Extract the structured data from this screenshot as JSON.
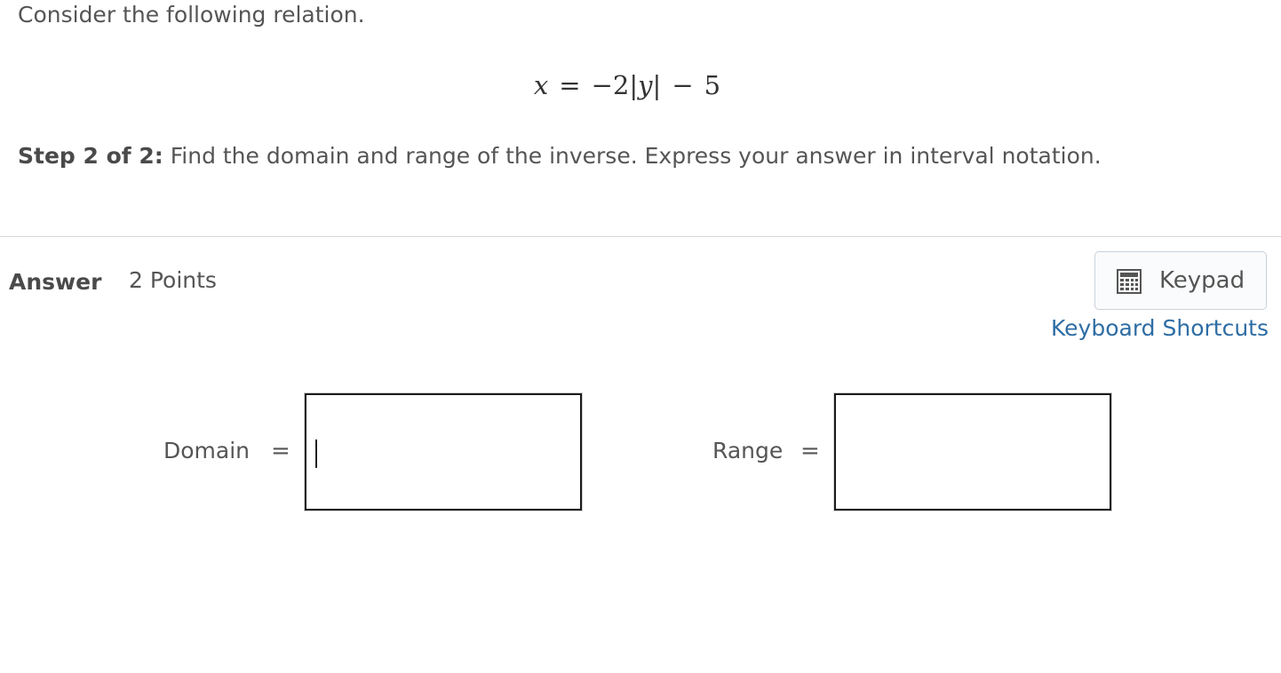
{
  "question": {
    "intro": "Consider the following relation.",
    "equation": {
      "lhs": "x",
      "equals": "=",
      "minus": "−",
      "coefficient": "2",
      "abs_open": "|",
      "variable": "y",
      "abs_close": "|",
      "minus2": "−",
      "constant": "5"
    },
    "step_label": "Step 2 of 2:",
    "step_text": " Find the domain and range of the inverse. Express your answer in interval notation."
  },
  "answer": {
    "label": "Answer",
    "points": "2 Points",
    "keypad_label": "Keypad",
    "keyboard_shortcuts_label": "Keyboard Shortcuts",
    "fields": {
      "domain": {
        "label": "Domain",
        "equals": "=",
        "value": ""
      },
      "range": {
        "label": "Range",
        "equals": "=",
        "value": ""
      }
    }
  },
  "colors": {
    "link": "#2e6da4",
    "text": "#555555",
    "divider": "#d6d6d6"
  }
}
